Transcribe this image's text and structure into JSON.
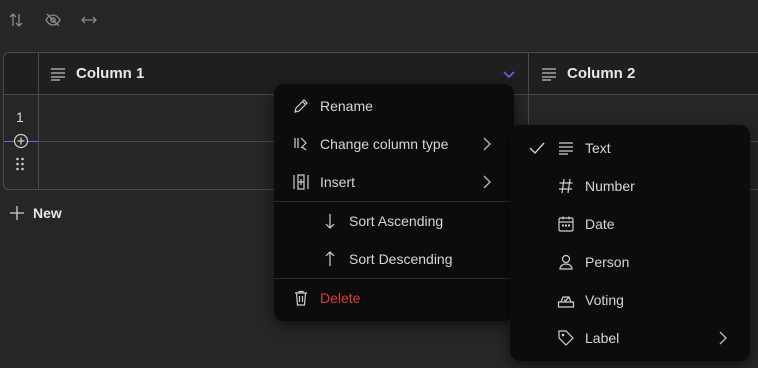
{
  "toolbar": {
    "icons": [
      "sort-arrows-icon",
      "hide-eye-icon",
      "resize-arrows-icon"
    ]
  },
  "table": {
    "columns": [
      {
        "title": "Column 1"
      },
      {
        "title": "Column 2"
      }
    ],
    "row_number": "1",
    "new_label": "New",
    "accent": "#7b5cf0"
  },
  "context_menu": {
    "rename": "Rename",
    "change_type": "Change column type",
    "insert": "Insert",
    "sort_asc": "Sort Ascending",
    "sort_desc": "Sort Descending",
    "delete": "Delete",
    "delete_color": "#e03c3c"
  },
  "type_menu": {
    "items": [
      "Text",
      "Number",
      "Date",
      "Person",
      "Voting",
      "Label"
    ],
    "selected": "Text"
  }
}
